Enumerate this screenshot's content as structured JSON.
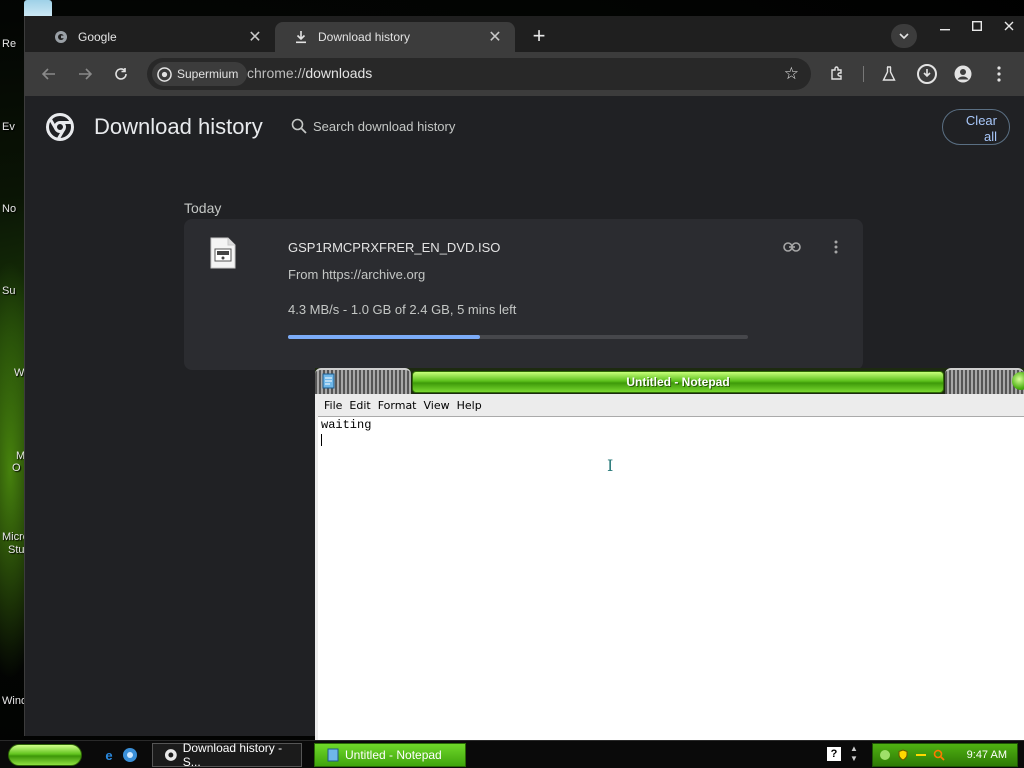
{
  "desktop": {
    "icon_labels": [
      "Re",
      "Ev",
      "No",
      "Su",
      "W",
      "M",
      "O",
      "Micro",
      "Stu",
      "Wind"
    ]
  },
  "browser": {
    "tabs": [
      {
        "title": "Google",
        "icon": "google-icon",
        "active": false
      },
      {
        "title": "Download history",
        "icon": "download-icon",
        "active": true
      }
    ],
    "new_tab_glyph": "+",
    "omnibox": {
      "chip_label": "Supermium",
      "url_scheme": "chrome://",
      "url_host": "downloads"
    }
  },
  "downloads_page": {
    "title": "Download history",
    "search_placeholder": "Search download history",
    "clear_all_line1": "Clear",
    "clear_all_line2": "all",
    "section_date": "Today",
    "items": [
      {
        "file_name": "GSP1RMCPRXFRER_EN_DVD.ISO",
        "source": "From https://archive.org",
        "status": "4.3 MB/s - 1.0 GB of 2.4 GB, 5 mins left",
        "progress": 0.4167
      }
    ],
    "accent_color": "#7cacf8"
  },
  "notepad": {
    "title": "Untitled - Notepad",
    "menu": [
      "File",
      "Edit",
      "Format",
      "View",
      "Help"
    ],
    "content": "waiting"
  },
  "taskbar": {
    "tasks": [
      {
        "label": "Download history - S...",
        "icon": "chrome-icon"
      },
      {
        "label": "Untitled - Notepad",
        "icon": "notepad-icon"
      }
    ],
    "help_glyph": "?",
    "clock": "9:47 AM"
  }
}
